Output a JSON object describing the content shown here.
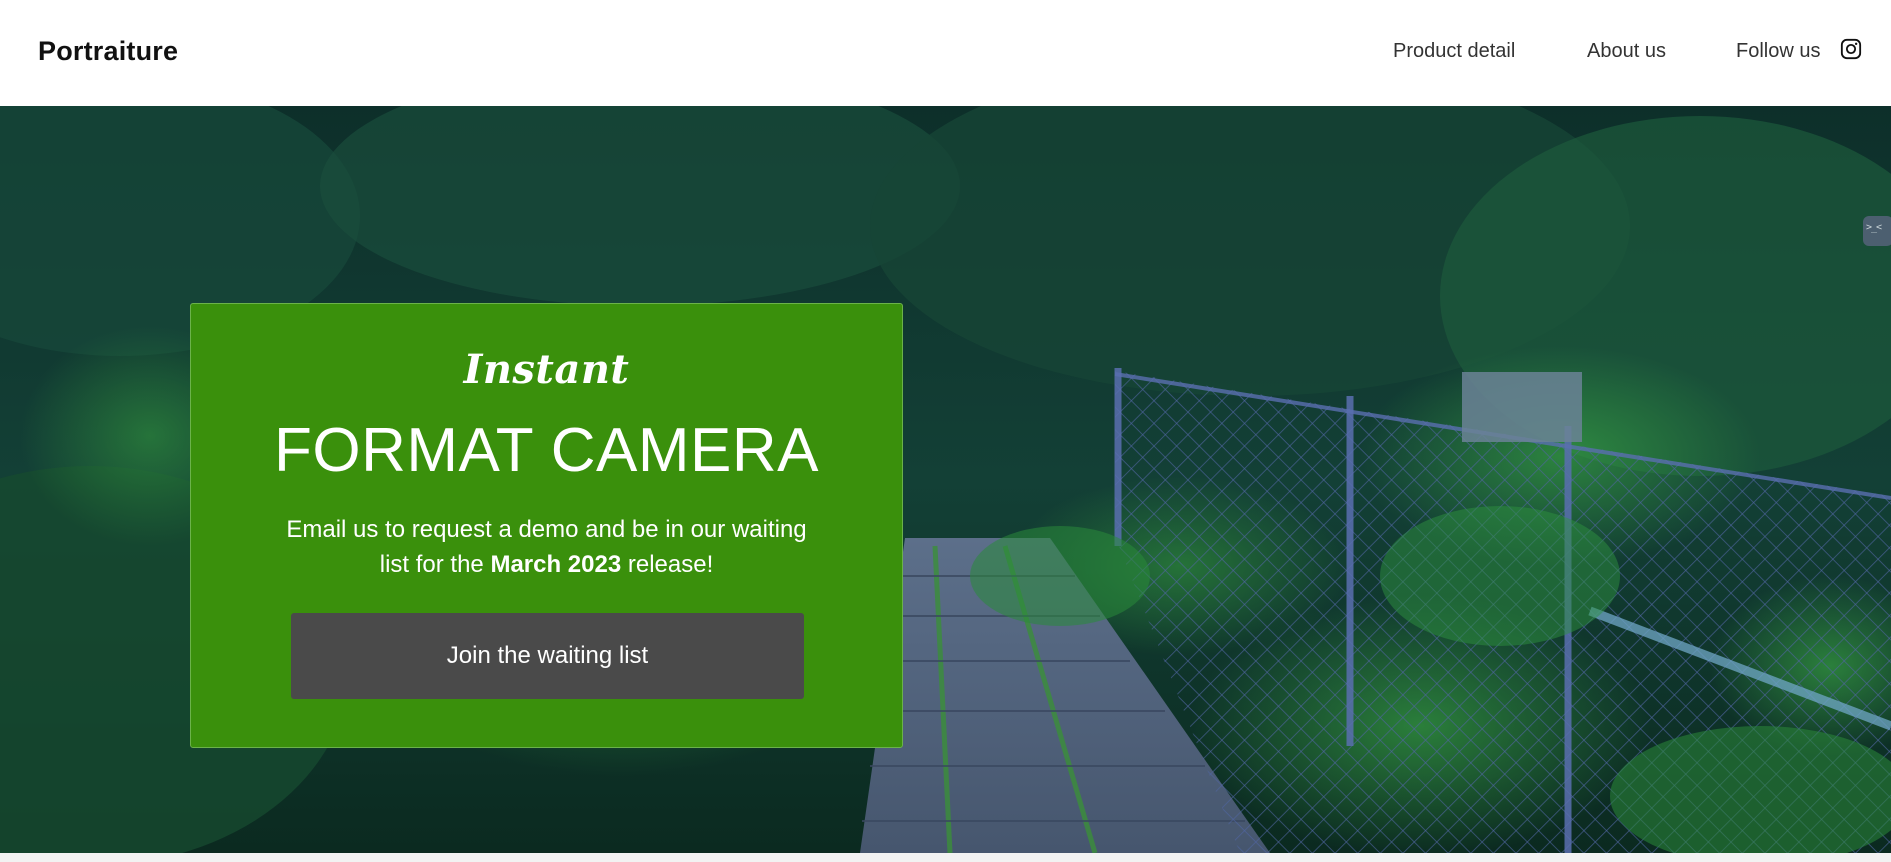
{
  "header": {
    "logo": "Portraiture",
    "nav": {
      "product_detail": "Product detail",
      "about_us": "About us",
      "follow_us": "Follow us"
    },
    "social_icon": "instagram-icon"
  },
  "hero": {
    "eyebrow": "Instant",
    "title": "FORMAT CAMERA",
    "text_before": "Email us to request a demo and be in our waiting list for the ",
    "text_highlight": "March 2023",
    "text_after": " release!",
    "cta_label": "Join the waiting list",
    "side_tab_icon": "devtools-icon",
    "side_tab_glyph": ">_<"
  },
  "colors": {
    "card_background": "#3a900c",
    "button_background": "#4a4a4a",
    "header_background": "#ffffff"
  }
}
